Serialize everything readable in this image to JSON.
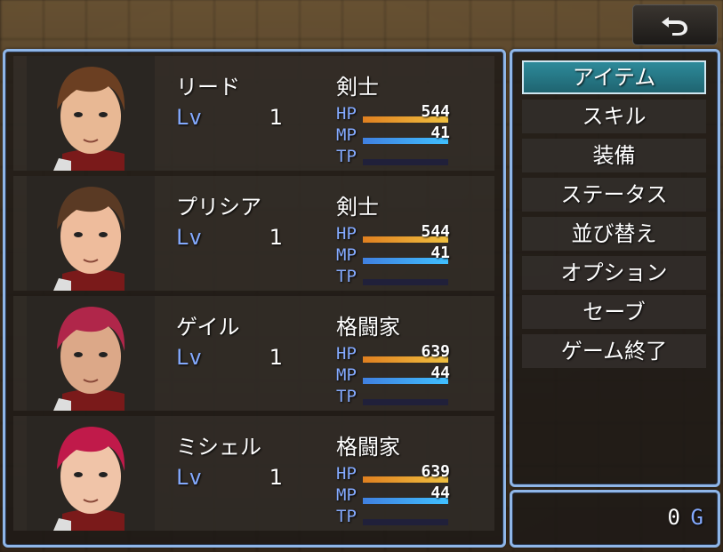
{
  "actors": [
    {
      "name": "リード",
      "class": "剣士",
      "lv_label": "Lv",
      "level": "1",
      "hp_label": "HP",
      "hp": "544",
      "hp_ratio": 1.0,
      "mp_label": "MP",
      "mp": "41",
      "mp_ratio": 1.0,
      "tp_label": "TP",
      "hair": "#6b3f22",
      "skin": "#e8b894"
    },
    {
      "name": "プリシア",
      "class": "剣士",
      "lv_label": "Lv",
      "level": "1",
      "hp_label": "HP",
      "hp": "544",
      "hp_ratio": 1.0,
      "mp_label": "MP",
      "mp": "41",
      "mp_ratio": 1.0,
      "tp_label": "TP",
      "hair": "#5a3a24",
      "skin": "#eebc9c"
    },
    {
      "name": "ゲイル",
      "class": "格闘家",
      "lv_label": "Lv",
      "level": "1",
      "hp_label": "HP",
      "hp": "639",
      "hp_ratio": 1.0,
      "mp_label": "MP",
      "mp": "44",
      "mp_ratio": 1.0,
      "tp_label": "TP",
      "hair": "#b0264a",
      "skin": "#dca888"
    },
    {
      "name": "ミシェル",
      "class": "格闘家",
      "lv_label": "Lv",
      "level": "1",
      "hp_label": "HP",
      "hp": "639",
      "hp_ratio": 1.0,
      "mp_label": "MP",
      "mp": "44",
      "mp_ratio": 1.0,
      "tp_label": "TP",
      "hair": "#c01a4a",
      "skin": "#f0c4a8"
    }
  ],
  "commands": [
    "アイテム",
    "スキル",
    "装備",
    "ステータス",
    "並び替え",
    "オプション",
    "セーブ",
    "ゲーム終了"
  ],
  "selected_command": "アイテム",
  "gold": {
    "value": "0",
    "unit": "G"
  },
  "back_icon": "return-arrow-icon"
}
